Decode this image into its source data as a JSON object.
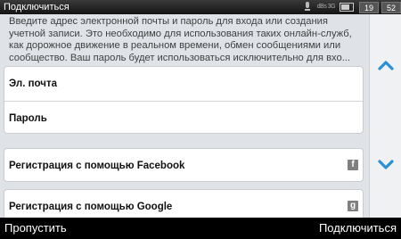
{
  "status_bar": {
    "title": "Подключиться",
    "signal_text": "dBs 3G",
    "left_box": "19",
    "right_box": "52"
  },
  "main": {
    "description": "Введите адрес электронной почты и пароль для входа или создания учетной записи. Это необходимо для использования таких онлайн-служб, как дорожное движение в реальном времени, обмен сообщениями или сообщество. Ваш пароль будет использоваться исключительно для вхо...",
    "email_label": "Эл. почта",
    "password_label": "Пароль",
    "facebook_label": "Регистрация с помощью Facebook",
    "google_label": "Регистрация с помощью Google",
    "facebook_icon_glyph": "f",
    "google_icon_glyph": "g"
  },
  "side_panel": {
    "up_icon": "chevron-up-icon",
    "down_icon": "chevron-down-icon",
    "arrow_color": "#2a8fd6"
  },
  "bottom_bar": {
    "skip_label": "Пропустить",
    "connect_label": "Подключиться"
  }
}
